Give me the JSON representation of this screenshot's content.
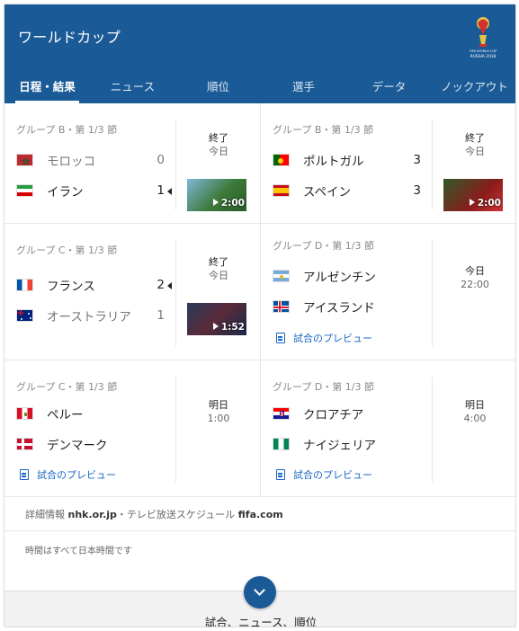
{
  "header": {
    "title": "ワールドカップ",
    "logo_text": "FIFA WORLD CUP RUSSIA 2018",
    "tabs": [
      "日程・結果",
      "ニュース",
      "順位",
      "選手",
      "データ",
      "ノックアウト"
    ]
  },
  "matches": [
    {
      "group": "グループ B・第 1/3 節",
      "home": {
        "name": "モロッコ",
        "score": "0",
        "flag": "morocco-flag-icon"
      },
      "away": {
        "name": "イラン",
        "score": "1",
        "flag": "iran-flag-icon"
      },
      "status": "終了",
      "status_sub": "今日",
      "video_duration": "2:00"
    },
    {
      "group": "グループ B・第 1/3 節",
      "home": {
        "name": "ポルトガル",
        "score": "3",
        "flag": "portugal-flag-icon"
      },
      "away": {
        "name": "スペイン",
        "score": "3",
        "flag": "spain-flag-icon"
      },
      "status": "終了",
      "status_sub": "今日",
      "video_duration": "2:00"
    },
    {
      "group": "グループ C・第 1/3 節",
      "home": {
        "name": "フランス",
        "score": "2",
        "flag": "france-flag-icon"
      },
      "away": {
        "name": "オーストラリア",
        "score": "1",
        "flag": "australia-flag-icon"
      },
      "status": "終了",
      "status_sub": "今日",
      "video_duration": "1:52"
    },
    {
      "group": "グループ D・第 1/3 節",
      "home": {
        "name": "アルゼンチン",
        "flag": "argentina-flag-icon"
      },
      "away": {
        "name": "アイスランド",
        "flag": "iceland-flag-icon"
      },
      "status": "今日",
      "status_sub": "22:00",
      "preview": "試合のプレビュー"
    },
    {
      "group": "グループ C・第 1/3 節",
      "home": {
        "name": "ペルー",
        "flag": "peru-flag-icon"
      },
      "away": {
        "name": "デンマーク",
        "flag": "denmark-flag-icon"
      },
      "status": "明日",
      "status_sub": "1:00",
      "preview": "試合のプレビュー"
    },
    {
      "group": "グループ D・第 1/3 節",
      "home": {
        "name": "クロアチア",
        "flag": "croatia-flag-icon"
      },
      "away": {
        "name": "ナイジェリア",
        "flag": "nigeria-flag-icon"
      },
      "status": "明日",
      "status_sub": "4:00",
      "preview": "試合のプレビュー"
    }
  ],
  "source": {
    "label1": "詳細情報",
    "link1": "nhk.or.jp",
    "sep": "・テレビ放送スケジュール",
    "link2": "fifa.com"
  },
  "timezone_note": "時間はすべて日本時間です",
  "footer_label": "試合、ニュース、順位",
  "colors": {
    "header": "#1a5a96",
    "link": "#1a66c4"
  }
}
